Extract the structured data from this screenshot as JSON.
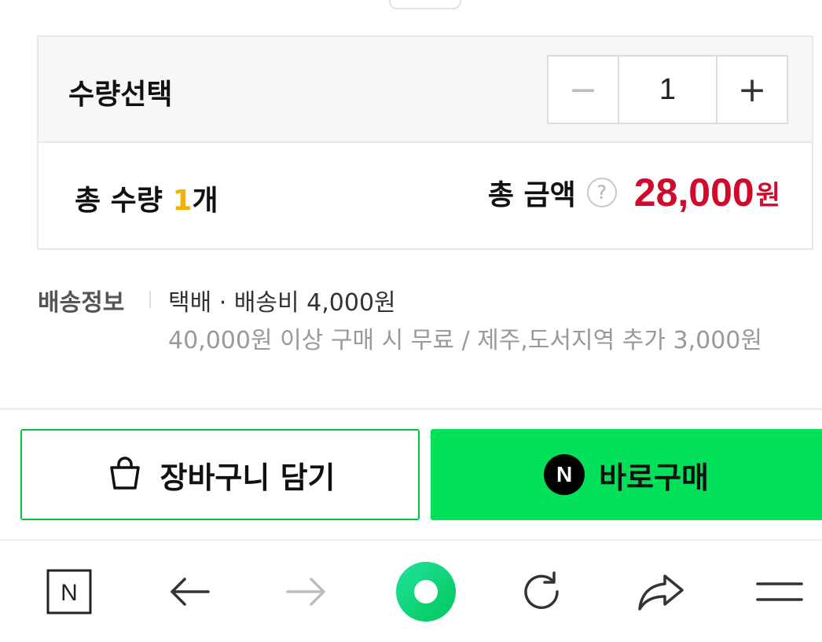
{
  "quantity": {
    "label": "수량선택",
    "minus": "−",
    "value": "1",
    "plus": "+"
  },
  "totals": {
    "qty_prefix": "총 수량 ",
    "qty_number": "1",
    "qty_suffix": "개",
    "amount_label": "총 금액",
    "help": "?",
    "amount_value": "28,000",
    "amount_unit": "원"
  },
  "shipping": {
    "label": "배송정보",
    "main": "택배 · 배송비 4,000원",
    "sub": "40,000원 이상 구매 시 무료 / 제주,도서지역 추가 3,000원"
  },
  "actions": {
    "cart_label": "장바구니 담기",
    "buy_badge": "N",
    "buy_label": "바로구매"
  },
  "browser_bar": {
    "icons": [
      "naver-home-icon",
      "back-arrow-icon",
      "forward-arrow-icon",
      "green-dot-icon",
      "refresh-icon",
      "share-icon",
      "menu-icon"
    ],
    "home_letter": "N"
  },
  "colors": {
    "accent_green": "#03e05a",
    "border_green": "#00c73c",
    "price_red": "#d10a2c",
    "qty_yellow": "#f0b400"
  }
}
